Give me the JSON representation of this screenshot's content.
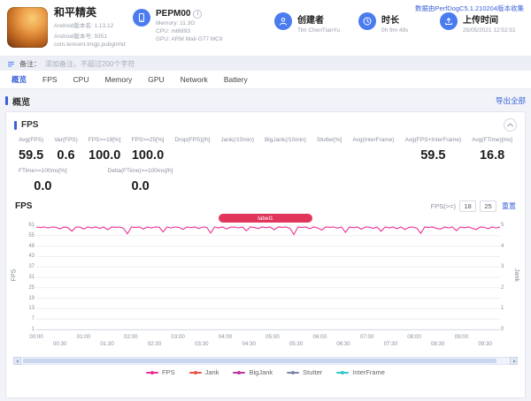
{
  "header": {
    "app": {
      "title": "和平精英",
      "version_name": "Android版本名: 1.13.12",
      "version_code": "Android版本号: 9351",
      "package": "com.tencent.tmgp.pubgmhd"
    },
    "device": {
      "model": "PEPM00",
      "memory": "Memory: 11.3G",
      "cpu": "CPU: mt6893",
      "gpu": "GPU: ARM Mali-G77 MC9"
    },
    "creator": {
      "label": "创建者",
      "value": "Tim ChenTianYu"
    },
    "duration": {
      "label": "时长",
      "value": "0h 9m 49s"
    },
    "upload": {
      "label": "上传时间",
      "value": "25/05/2021 12:52:51"
    },
    "collector_note": "数据由PerfDogC5.1.210204版本收集"
  },
  "note_bar": {
    "label": "备注：",
    "placeholder": "添加备注，不超过200个字符"
  },
  "tabs": [
    {
      "label": "概览",
      "active": true
    },
    {
      "label": "FPS"
    },
    {
      "label": "CPU"
    },
    {
      "label": "Memory"
    },
    {
      "label": "GPU"
    },
    {
      "label": "Network"
    },
    {
      "label": "Battery"
    }
  ],
  "section": {
    "title": "概览",
    "export_all": "导出全部"
  },
  "fps_panel": {
    "title": "FPS",
    "stats_row1": [
      {
        "label": "Avg(FPS)",
        "value": "59.5"
      },
      {
        "label": "Var(FPS)",
        "value": "0.6"
      },
      {
        "label": "FPS>=18[%]",
        "value": "100.0"
      },
      {
        "label": "FPS>=25[%]",
        "value": "100.0"
      },
      {
        "label": "Drop(FPS)[/h]",
        "value": ""
      },
      {
        "label": "Jank(/10min)",
        "value": ""
      },
      {
        "label": "BigJank(/10min)",
        "value": ""
      },
      {
        "label": "Stutter[%]",
        "value": ""
      },
      {
        "label": "Avg(InterFrame)",
        "value": ""
      },
      {
        "label": "Avg(FPS+InterFrame)",
        "value": "59.5"
      },
      {
        "label": "Avg(FTime)[ms]",
        "value": "16.8"
      }
    ],
    "stats_row2": [
      {
        "label": "FTime>=100ms[%]",
        "value": "0.0"
      },
      {
        "label": "Delta(FTime)>=100ms[/h]",
        "value": "0.0"
      }
    ],
    "chart_title": "FPS",
    "threshold": {
      "label": "FPS(>=)",
      "low": "18",
      "high": "25",
      "reset": "重置"
    },
    "marker_label": "label1"
  },
  "chart_data": {
    "type": "line",
    "title": "FPS",
    "ylabel_left": "FPS",
    "ylabel_right": "Jank",
    "ylim": [
      1,
      61
    ],
    "grid": true,
    "legend_position": "bottom",
    "y_ticks_left": [
      61,
      55,
      49,
      43,
      37,
      31,
      25,
      19,
      13,
      7,
      1
    ],
    "y_ticks_right": [
      5,
      4,
      3,
      2,
      1,
      0
    ],
    "x_total_seconds": 589,
    "x_tick_interval_seconds": 30,
    "x_ticks": [
      "00:00",
      "00:30",
      "01:00",
      "01:30",
      "02:00",
      "02:30",
      "03:00",
      "03:30",
      "04:00",
      "04:30",
      "05:00",
      "05:30",
      "06:00",
      "06:30",
      "07:00",
      "07:30",
      "08:00",
      "08:30",
      "09:00",
      "09:30"
    ],
    "series": [
      {
        "name": "FPS",
        "color": "#eb2f96",
        "values": [
          60,
          59.7,
          60,
          59.4,
          60,
          59.8,
          58.9,
          60,
          59.6,
          57.6,
          60,
          59.9,
          58.8,
          60,
          59.5,
          60,
          59.2,
          60,
          58.4,
          60,
          59.8,
          60,
          59.3,
          56,
          60,
          59.7,
          60,
          58.8,
          60,
          59.5,
          60,
          59.9,
          57.2,
          60,
          59.4,
          60,
          59.8,
          58.6,
          60,
          59.6,
          60,
          59.1,
          60,
          59.8,
          56.5,
          60,
          59.5,
          60,
          58.9,
          59.9,
          60,
          59.4,
          60,
          57.8,
          60,
          59.7,
          59.1,
          60,
          59.6,
          60,
          58.4,
          60,
          59.8,
          60,
          59.2,
          55.6,
          60,
          59.7,
          60,
          59,
          60,
          59.5,
          58.2,
          60,
          59.8,
          60,
          59.3,
          60,
          56.9,
          60,
          59.6,
          60,
          58.7,
          60,
          59.9,
          59.2,
          60,
          57.5,
          60,
          59.5,
          60,
          59,
          60,
          58.5,
          59.8,
          60,
          59.3,
          56.3,
          60,
          59.7,
          60,
          59.1,
          58.8,
          60,
          59.5,
          60,
          57.9,
          60,
          59.6,
          60,
          59.2,
          58.5,
          60,
          59.8,
          59,
          60,
          59.4,
          60
        ]
      }
    ],
    "legend": [
      {
        "name": "FPS",
        "color": "#eb2f96"
      },
      {
        "name": "Jank",
        "color": "#e8544a"
      },
      {
        "name": "BigJank",
        "color": "#bd34a0"
      },
      {
        "name": "Stutter",
        "color": "#7c87a5"
      },
      {
        "name": "InterFrame",
        "color": "#2fc7c9"
      }
    ]
  }
}
